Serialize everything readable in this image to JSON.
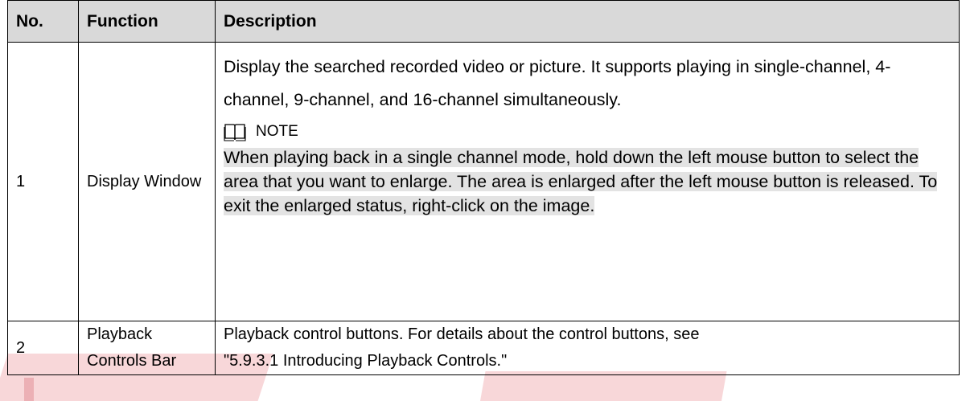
{
  "table": {
    "headers": {
      "no": "No.",
      "function": "Function",
      "description": "Description"
    },
    "rows": [
      {
        "no": "1",
        "function": "Display Window",
        "description": "Display the searched recorded video or picture. It supports playing in single-channel, 4-channel, 9-channel, and 16-channel simultaneously.",
        "note_label": "NOTE",
        "note_icon": "book-icon",
        "note_text": "When playing back in a single channel mode, hold down the left mouse button to select the area that you want to enlarge. The area is enlarged after the left mouse button is released. To exit the enlarged status, right-click on the image."
      },
      {
        "no": "2",
        "function_line1": "Playback",
        "function_line2": "Controls Bar",
        "description_line1": "Playback control buttons. For details about the control buttons, see",
        "description_line2": "\"5.9.3.1 Introducing Playback Controls.\""
      }
    ]
  },
  "colors": {
    "header_bg": "#d9d9d9",
    "highlight_bg": "#e3e3e3",
    "watermark": "#f6c9cc"
  }
}
